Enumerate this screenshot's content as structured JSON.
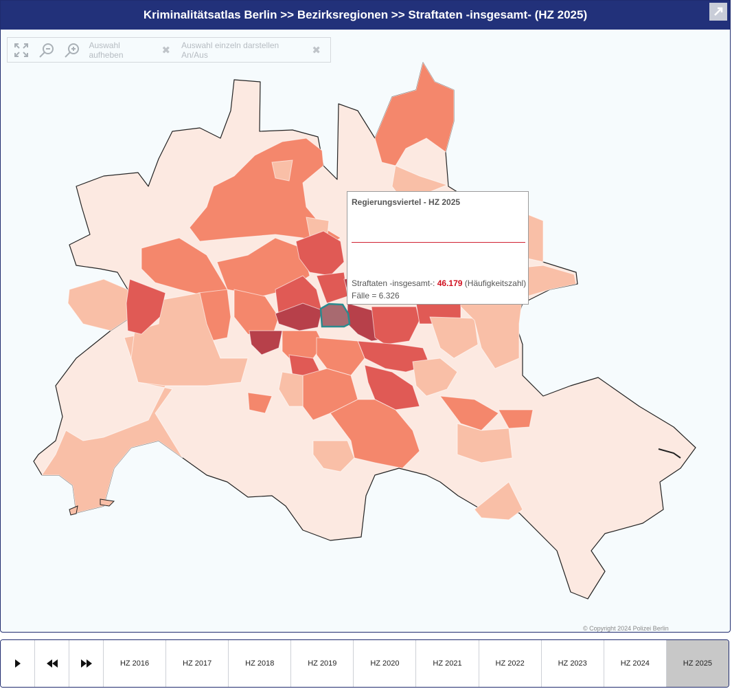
{
  "header": {
    "title": "Kriminalitätsatlas Berlin >> Bezirksregionen >>  Straftaten -insgesamt- (HZ 2025)"
  },
  "toolbar": {
    "clear_selection": "Auswahl aufheben",
    "single_toggle": "Auswahl einzeln darstellen An/Aus"
  },
  "tooltip": {
    "title": "Regierungsviertel - HZ 2025",
    "metric_label": "Straftaten -insgesamt-:",
    "metric_value": "46.179",
    "metric_unit": "(Häufigkeitszahl)",
    "cases": "Fälle = 6.326"
  },
  "copyright": "© Copyright 2024 Polizei Berlin",
  "timeline": {
    "years": [
      "HZ 2016",
      "HZ 2017",
      "HZ 2018",
      "HZ 2019",
      "HZ 2020",
      "HZ 2021",
      "HZ 2022",
      "HZ 2023",
      "HZ 2024",
      "HZ 2025"
    ],
    "active": "HZ 2025"
  },
  "colors": {
    "header_bg": "#22317a",
    "level1": "#fce9e1",
    "level2": "#f9bfa7",
    "level3": "#f4876c",
    "level4": "#e05a55",
    "level5": "#b7404a",
    "selected_outline": "#2a8b8f"
  }
}
